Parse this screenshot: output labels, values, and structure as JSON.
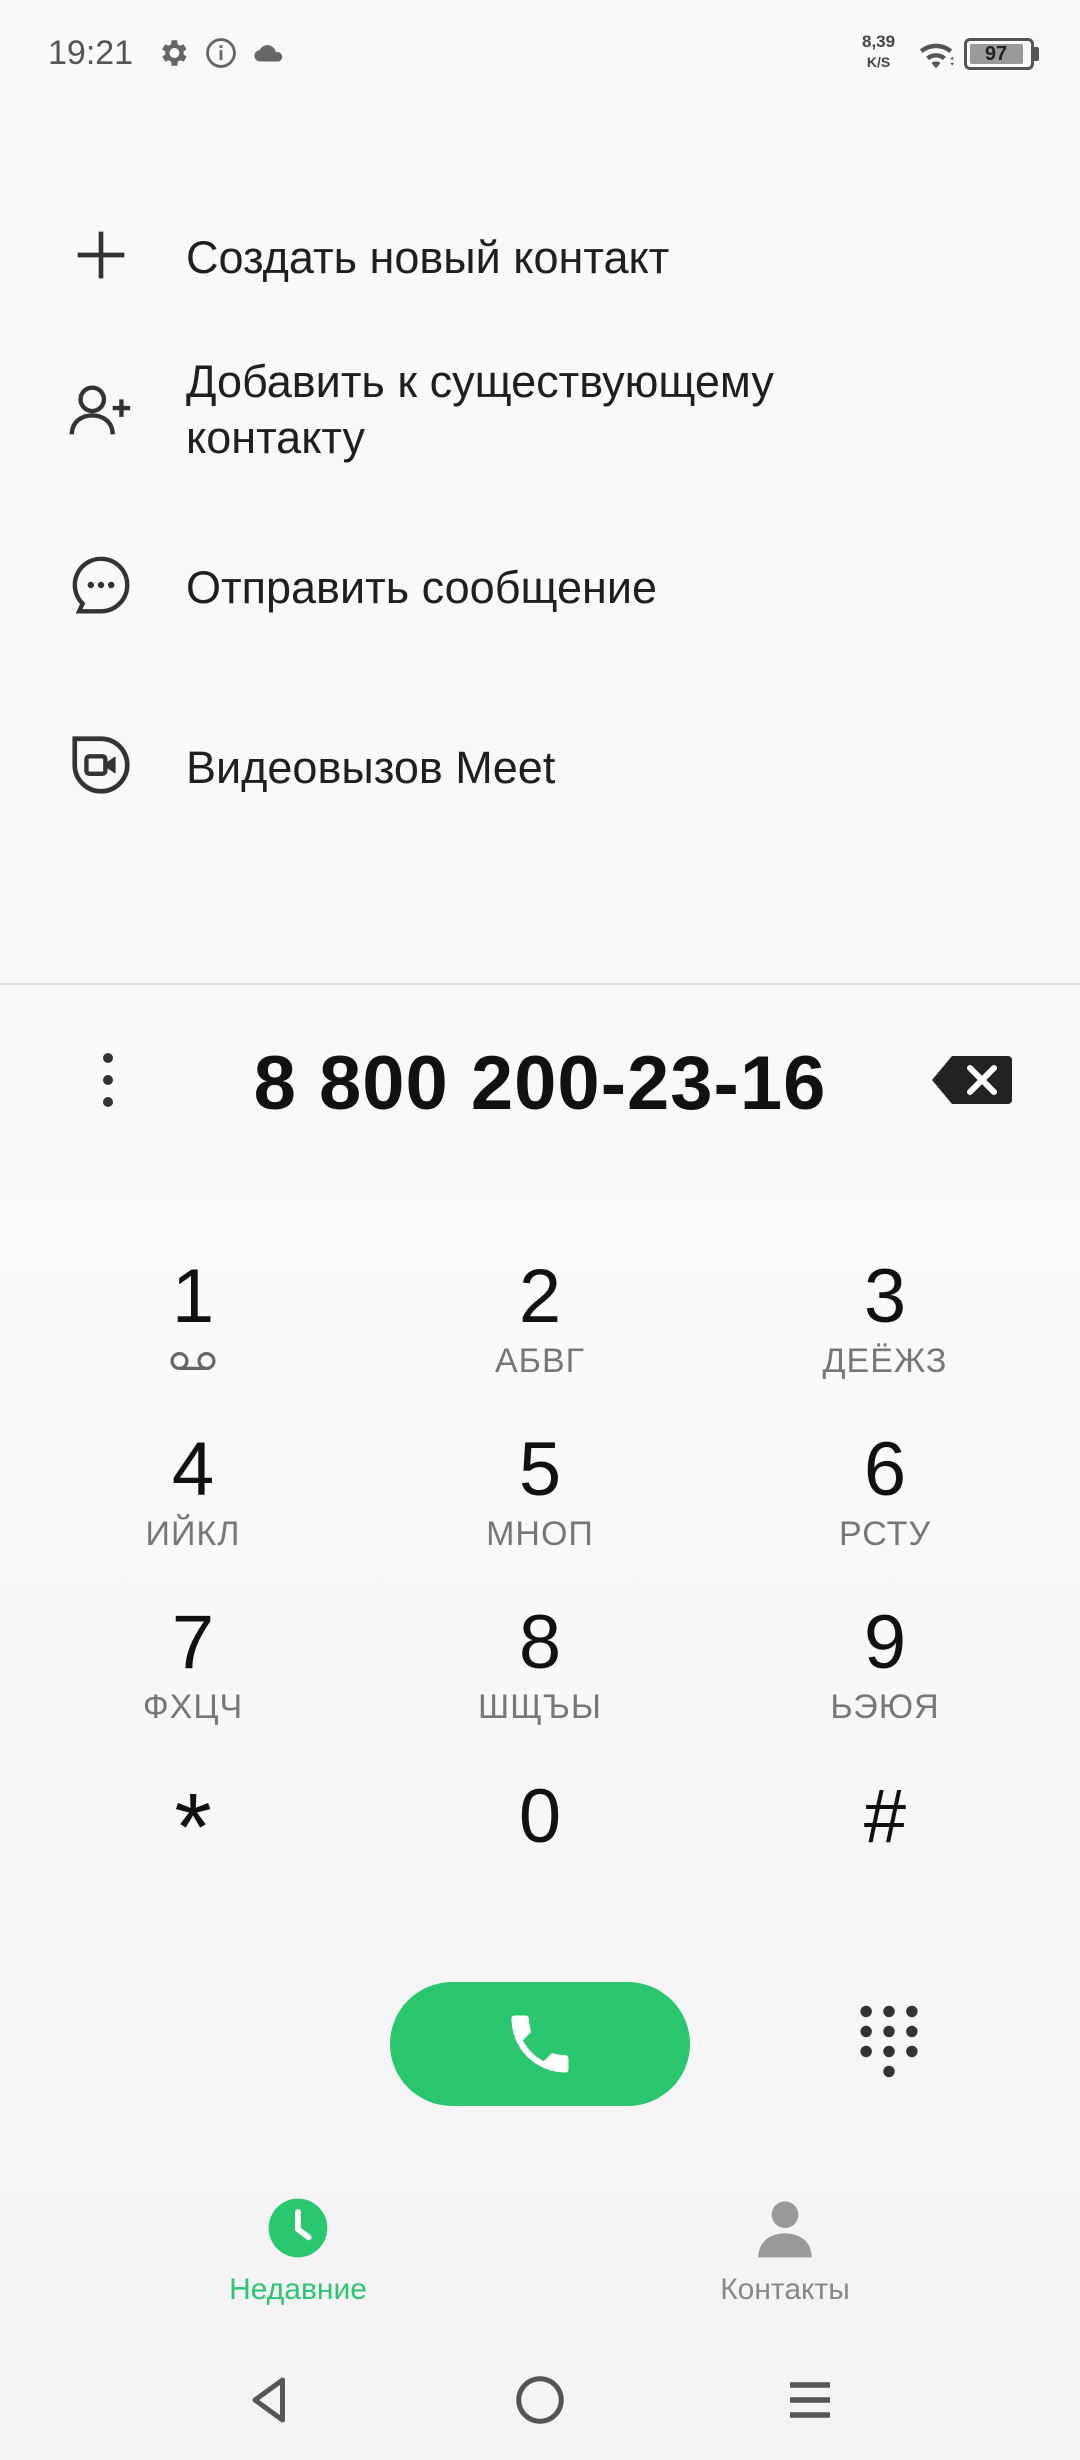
{
  "status_bar": {
    "time": "19:21",
    "speed_value": "8,39",
    "speed_unit": "K/S",
    "battery": "97",
    "icons": [
      "gear-icon",
      "info-icon",
      "cloud-icon",
      "wifi-icon",
      "battery-icon"
    ]
  },
  "actions": [
    {
      "label": "Создать новый контакт",
      "icon": "plus-icon"
    },
    {
      "label_line1": "Добавить к существующему",
      "label_line2": "контакту",
      "icon": "add-person-icon"
    },
    {
      "label": "Отправить сообщение",
      "icon": "message-bubble-icon"
    },
    {
      "label": "Видеовызов Meet",
      "icon": "meet-video-icon"
    }
  ],
  "dialer": {
    "number": "8 800 200-23-16"
  },
  "keypad": [
    {
      "digit": "1",
      "letters": ""
    },
    {
      "digit": "2",
      "letters": "АБВГ"
    },
    {
      "digit": "3",
      "letters": "ДЕЁЖЗ"
    },
    {
      "digit": "4",
      "letters": "ИЙКЛ"
    },
    {
      "digit": "5",
      "letters": "МНОП"
    },
    {
      "digit": "6",
      "letters": "РСТУ"
    },
    {
      "digit": "7",
      "letters": "ФХЦЧ"
    },
    {
      "digit": "8",
      "letters": "ШЩЪЫ"
    },
    {
      "digit": "9",
      "letters": "ЬЭЮЯ"
    },
    {
      "digit": "*",
      "letters": ""
    },
    {
      "digit": "0",
      "letters": ""
    },
    {
      "digit": "#",
      "letters": ""
    }
  ],
  "tabs": [
    {
      "label": "Недавние",
      "icon": "clock-icon",
      "active": true
    },
    {
      "label": "Контакты",
      "icon": "person-icon",
      "active": false
    }
  ],
  "colors": {
    "accent": "#2ac76f",
    "text": "#1f1f1f",
    "secondary": "#777777"
  }
}
